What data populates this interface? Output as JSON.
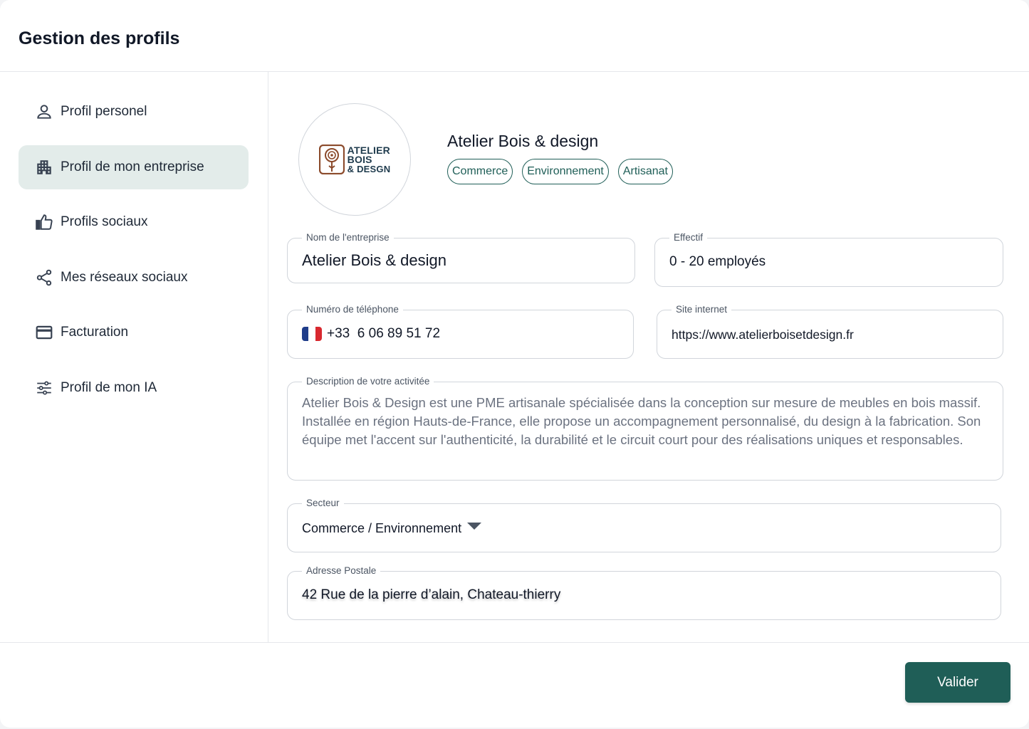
{
  "page": {
    "title": "Gestion des profils"
  },
  "sidebar": {
    "items": [
      {
        "label": "Profil personel",
        "icon": "user-icon",
        "active": false
      },
      {
        "label": "Profil de mon entreprise",
        "icon": "building-icon",
        "active": true
      },
      {
        "label": "Profils sociaux",
        "icon": "thumbs-up-icon",
        "active": false
      },
      {
        "label": "Mes réseaux sociaux",
        "icon": "share-icon",
        "active": false
      },
      {
        "label": "Facturation",
        "icon": "credit-card-icon",
        "active": false
      },
      {
        "label": "Profil de mon IA",
        "icon": "sliders-icon",
        "active": false
      }
    ]
  },
  "company": {
    "logo": {
      "line1": "ATELIER",
      "line2": "BOIS",
      "line3": "& DESGN"
    },
    "name": "Atelier Bois & design",
    "tags": [
      "Commerce",
      "Environnement",
      "Artisanat"
    ]
  },
  "form": {
    "nom": {
      "label": "Nom de l'entreprise",
      "value": "Atelier Bois & design"
    },
    "effectif": {
      "label": "Effectif",
      "value": "0 - 20 employés"
    },
    "telephone": {
      "label": "Numéro de téléphone",
      "value": "+33  6 06 89 51 72"
    },
    "site": {
      "label": "Site internet",
      "value": "https://www.atelierboisetdesign.fr"
    },
    "description": {
      "label": "Description de votre activitée",
      "value": "Atelier Bois & Design est une PME artisanale spécialisée dans la conception sur mesure de meubles en bois massif. Installée en région Hauts-de-France, elle propose un accompagnement personnalisé, du design à la fabrication. Son équipe met l'accent sur l'authenticité, la durabilité et le circuit court pour des réalisations uniques et responsables."
    },
    "secteur": {
      "label": "Secteur",
      "value": "Commerce / Environnement"
    },
    "adresse": {
      "label": "Adresse Postale",
      "value": "42 Rue de la pierre d’alain, Chateau-thierry"
    }
  },
  "footer": {
    "validate_label": "Valider"
  },
  "colors": {
    "accent": "#1f5e57",
    "active_bg": "#e3ecea",
    "flag_blue": "#1f3d8a",
    "flag_red": "#d8282f"
  }
}
